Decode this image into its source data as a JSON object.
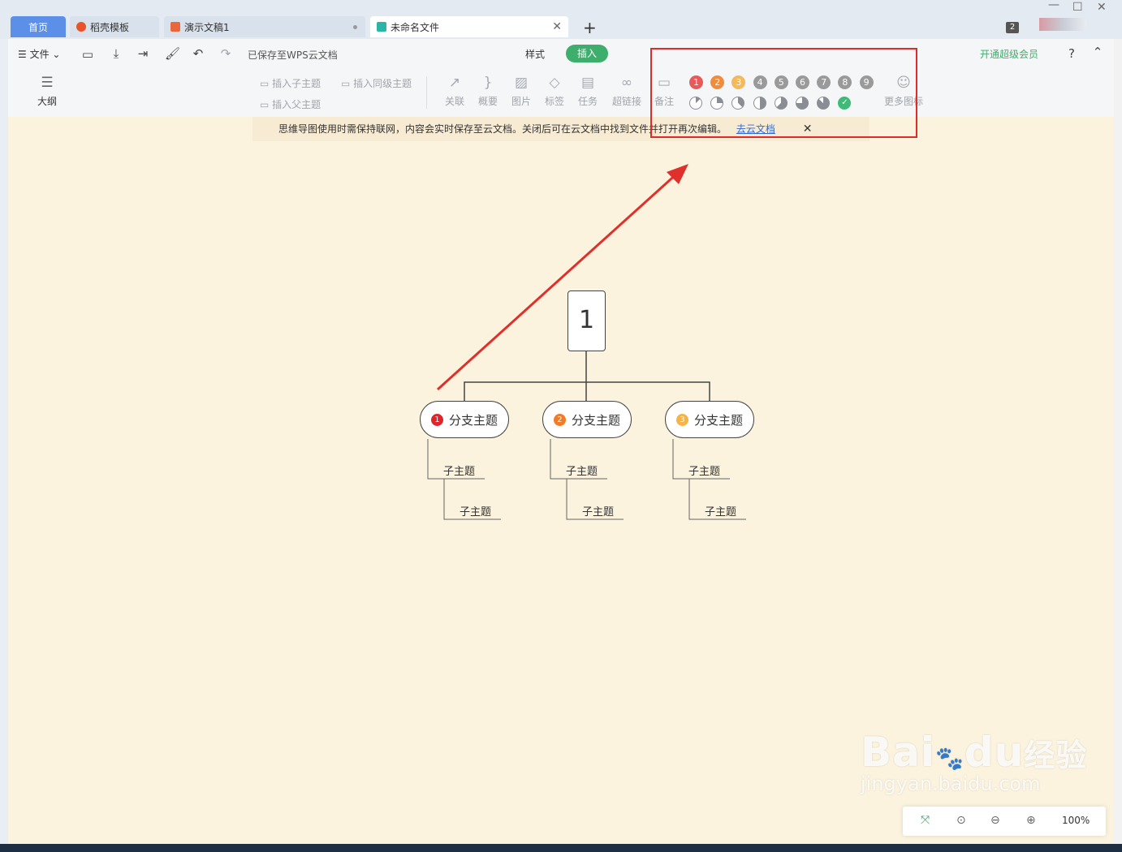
{
  "tabs": {
    "home": "首页",
    "daoke": "稻壳模板",
    "ppt": "演示文稿1",
    "active": "未命名文件",
    "window_count": "2"
  },
  "toolbar": {
    "file": "文件",
    "saved": "已保存至WPS云文档",
    "style_tab": "样式",
    "insert_tab": "插入",
    "vip": "开通超级会员",
    "outline": "大纲",
    "insert_child": "插入子主题",
    "insert_sibling": "插入同级主题",
    "insert_parent": "插入父主题",
    "relation": "关联",
    "summary": "概要",
    "image": "图片",
    "label": "标签",
    "task": "任务",
    "link": "超链接",
    "note": "备注",
    "more_icons": "更多图标",
    "priority_icons": [
      "1",
      "2",
      "3",
      "4",
      "5",
      "6",
      "7",
      "8",
      "9"
    ],
    "priority_colors": [
      "#e85a5a",
      "#f08c3c",
      "#f5b85a",
      "#9a9a9a",
      "#9a9a9a",
      "#9a9a9a",
      "#9a9a9a",
      "#9a9a9a",
      "#9a9a9a"
    ],
    "progress_levels": [
      0.125,
      0.25,
      0.375,
      0.5,
      0.625,
      0.75,
      0.875,
      1.0
    ]
  },
  "notice": {
    "text": "思维导图使用时需保持联网，内容会实时保存至云文档。关闭后可在云文档中找到文件并打开再次编辑。",
    "link": "去云文档"
  },
  "mindmap": {
    "root": "1",
    "branches": [
      {
        "label": "分支主题",
        "badge": "1",
        "color": "#e0242c"
      },
      {
        "label": "分支主题",
        "badge": "2",
        "color": "#f07c2a"
      },
      {
        "label": "分支主题",
        "badge": "3",
        "color": "#f5b445"
      }
    ],
    "sub": "子主题"
  },
  "zoom": {
    "value": "100%"
  },
  "watermark": {
    "brand": "Bai",
    "brand2": "du",
    "cn": "经验",
    "url": "jingyan.baidu.com"
  }
}
